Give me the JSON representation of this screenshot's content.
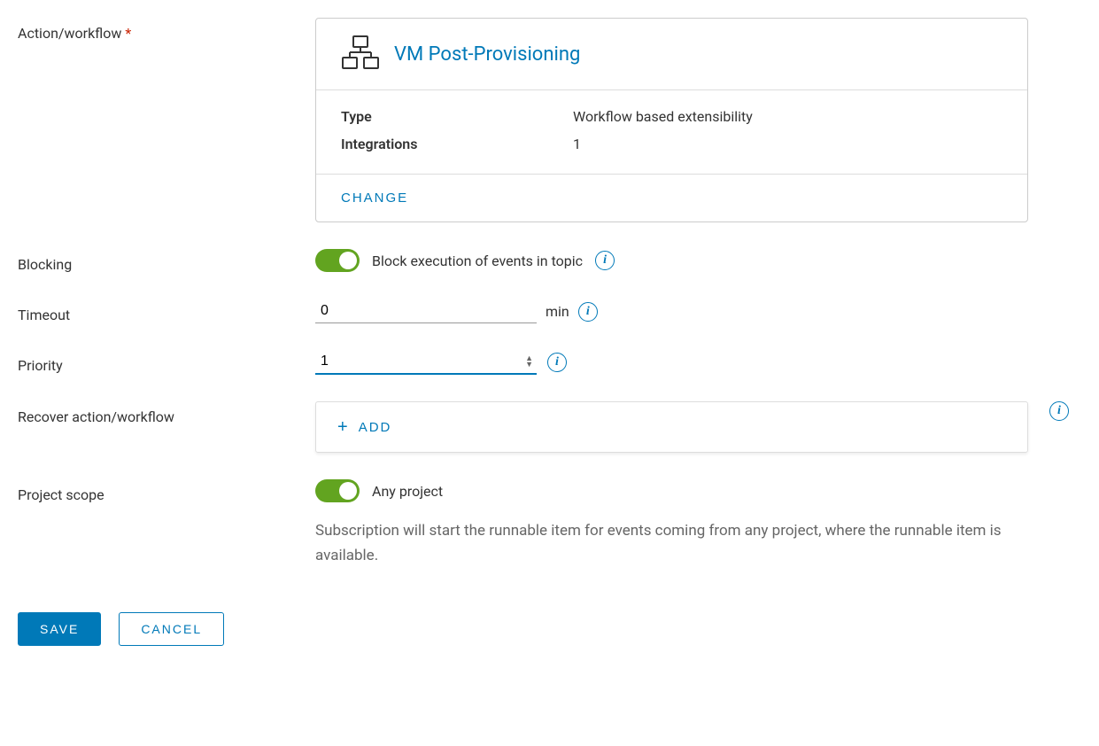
{
  "labels": {
    "action_workflow": "Action/workflow",
    "blocking": "Blocking",
    "timeout": "Timeout",
    "priority": "Priority",
    "recover": "Recover action/workflow",
    "project_scope": "Project scope"
  },
  "workflow": {
    "title": "VM Post-Provisioning",
    "type_label": "Type",
    "type_value": "Workflow based extensibility",
    "integrations_label": "Integrations",
    "integrations_value": "1",
    "change": "CHANGE"
  },
  "blocking": {
    "text": "Block execution of events in topic"
  },
  "timeout": {
    "value": "0",
    "unit": "min"
  },
  "priority": {
    "value": "1"
  },
  "recover": {
    "add": "ADD"
  },
  "scope": {
    "toggle_text": "Any project",
    "description": "Subscription will start the runnable item for events coming from any project, where the runnable item is available."
  },
  "buttons": {
    "save": "SAVE",
    "cancel": "CANCEL"
  }
}
